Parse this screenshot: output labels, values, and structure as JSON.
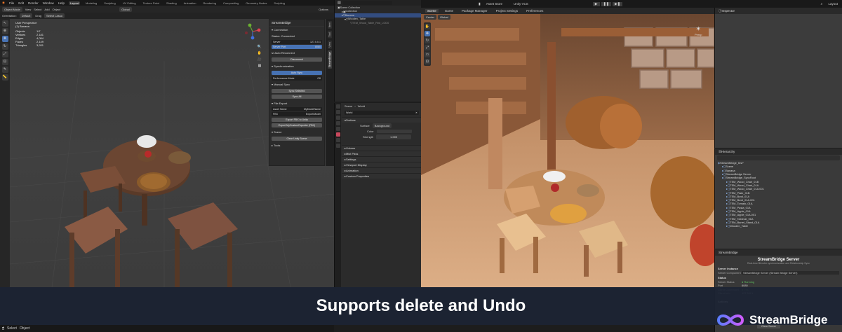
{
  "blender": {
    "menu": [
      "File",
      "Edit",
      "Render",
      "Window",
      "Help"
    ],
    "workspaces": [
      "Layout",
      "Modeling",
      "Sculpting",
      "UV Editing",
      "Texture Paint",
      "Shading",
      "Animation",
      "Rendering",
      "Compositing",
      "Geometry Nodes",
      "Scripting"
    ],
    "active_workspace": "Layout",
    "scene_label": "Scene",
    "viewlayer_label": "ViewLayer",
    "mode": "Object Mode",
    "header_menus": [
      "View",
      "Select",
      "Add",
      "Object"
    ],
    "transform": "Global",
    "options_label": "Options",
    "orientation_label": "Orientation:",
    "orientation_value": "Default",
    "drag_label": "Drag",
    "drag_value": "Select Lasso",
    "viewport_title": "User Perspective",
    "viewport_sub": "(1) Banana",
    "stats": [
      {
        "label": "Objects",
        "value": "1/7"
      },
      {
        "label": "Vertices",
        "value": "2,181"
      },
      {
        "label": "Edges",
        "value": "4,054"
      },
      {
        "label": "Faces",
        "value": "2,149"
      },
      {
        "label": "Triangles",
        "value": "3,931"
      }
    ],
    "npanel": {
      "title": "StreamBridge",
      "connection_head": "Connection",
      "status": "Status: Connected",
      "server_label": "Server",
      "server_value": "127.0.0.1",
      "port_label": "Server Port",
      "port_value": "8080",
      "auto_reconnect": "Auto Reconnect",
      "disconnect": "Disconnect",
      "sync_head": "Synchronization",
      "auto_sync": "Auto Sync",
      "perf_mode": "Performance Mode",
      "perf_value": "Off",
      "manual_head": "Manual Sync",
      "sync_selected": "Sync Selected",
      "sync_all": "Sync All",
      "file_head": "File Export",
      "asset_name_label": "Asset Name",
      "asset_name_value": "MyModelName",
      "fbx_label": "FBX",
      "fbx_value": "Export/Model",
      "export_fbx": "Export FBX to Unity",
      "export_custom": "Export MyCustomExporter (FBX)",
      "scene_head": "Scene",
      "clear_scene": "Clear Unity Scene",
      "tools_head": "Tools"
    },
    "ntabs": [
      "Item",
      "Tool",
      "View",
      "StreamBridge"
    ],
    "status_items": [
      "Select",
      "Object"
    ],
    "outliner": {
      "rows": [
        {
          "indent": 0,
          "text": "Scene Collection"
        },
        {
          "indent": 1,
          "text": "Collection"
        },
        {
          "indent": 1,
          "text": "Banana"
        },
        {
          "indent": 2,
          "text": "Wooden_Table"
        },
        {
          "indent": 3,
          "text": "TEM_Wood_Table_Rnd_LOD0"
        }
      ]
    },
    "props": {
      "scene": "Scene",
      "world": "World",
      "world_field": "World",
      "surface_head": "Surface",
      "surface_label": "Surface",
      "surface_value": "Background",
      "color_label": "Color",
      "strength_label": "Strength",
      "strength_value": "1.000",
      "sections": [
        "Volume",
        "Mist Pass",
        "Settings",
        "Viewport Display",
        "Animation",
        "Custom Properties"
      ]
    }
  },
  "unity": {
    "top_center": [
      "Asset Store",
      "Unity VCS"
    ],
    "top_right": "Layout",
    "tabs": [
      "Scene",
      "Game",
      "Package Manager",
      "Project Settings",
      "Preferences"
    ],
    "active_tab": "Scene",
    "scene_toolbar": [
      "Center",
      "Global"
    ],
    "persp_label": "Persp",
    "inspector_title": "Inspector",
    "hierarchy_title": "Hierarchy",
    "hierarchy": [
      {
        "indent": 0,
        "text": "StreamBridge_test*"
      },
      {
        "indent": 1,
        "text": "Scene"
      },
      {
        "indent": 1,
        "text": "Banana"
      },
      {
        "indent": 1,
        "text": "StreamBridge Server"
      },
      {
        "indent": 1,
        "text": "StreamBridge_SyncRoot"
      },
      {
        "indent": 2,
        "text": "TEM_Wood_Chair_01B"
      },
      {
        "indent": 2,
        "text": "TEM_Wood_Chair_01A"
      },
      {
        "indent": 2,
        "text": "TEM_Wood_Chair_01A.001"
      },
      {
        "indent": 2,
        "text": "TEM_Plate_01B"
      },
      {
        "indent": 2,
        "text": "TEM_Bowl_01A"
      },
      {
        "indent": 2,
        "text": "TEM_Bowl_01A.001"
      },
      {
        "indent": 2,
        "text": "TEM_Tomato_01A"
      },
      {
        "indent": 2,
        "text": "TEM_Pasta_01A"
      },
      {
        "indent": 2,
        "text": "TEM_Apple_01A"
      },
      {
        "indent": 2,
        "text": "TEM_Apple_01A.001"
      },
      {
        "indent": 2,
        "text": "TEM_Tablerat_01A"
      },
      {
        "indent": 2,
        "text": "TEM_Barrel_Stand_01A"
      },
      {
        "indent": 2,
        "text": "Wooden_Table"
      }
    ],
    "sb_tab": "StreamBridge",
    "sb_title": "StreamBridge Server",
    "sb_subtitle": "Real-time Blender synchronization and Relationship Sync",
    "server_instance_head": "Server Instance",
    "server_component_label": "Server Component",
    "server_component_value": "StreamBridge Server (Stream Bridge Server)",
    "status_head": "Status",
    "status_rows": [
      {
        "k": "Server Status",
        "v": "Running"
      },
      {
        "k": "Port",
        "v": "8080"
      },
      {
        "k": "Client Connected",
        "v": "Yes"
      },
      {
        "k": "Client Info",
        "v": "127.0.0.1"
      }
    ],
    "actions_head": "Actions",
    "clear_scene": "Clear Scene"
  },
  "overlay": {
    "caption": "Supports delete and Undo",
    "brand": "StreamBridge"
  },
  "colors": {
    "blender_accent": "#4772b3",
    "unity_bg": "#383838",
    "banner": "#1c2434",
    "logo_gradient_a": "#5a7cff",
    "logo_gradient_b": "#d05cff"
  }
}
